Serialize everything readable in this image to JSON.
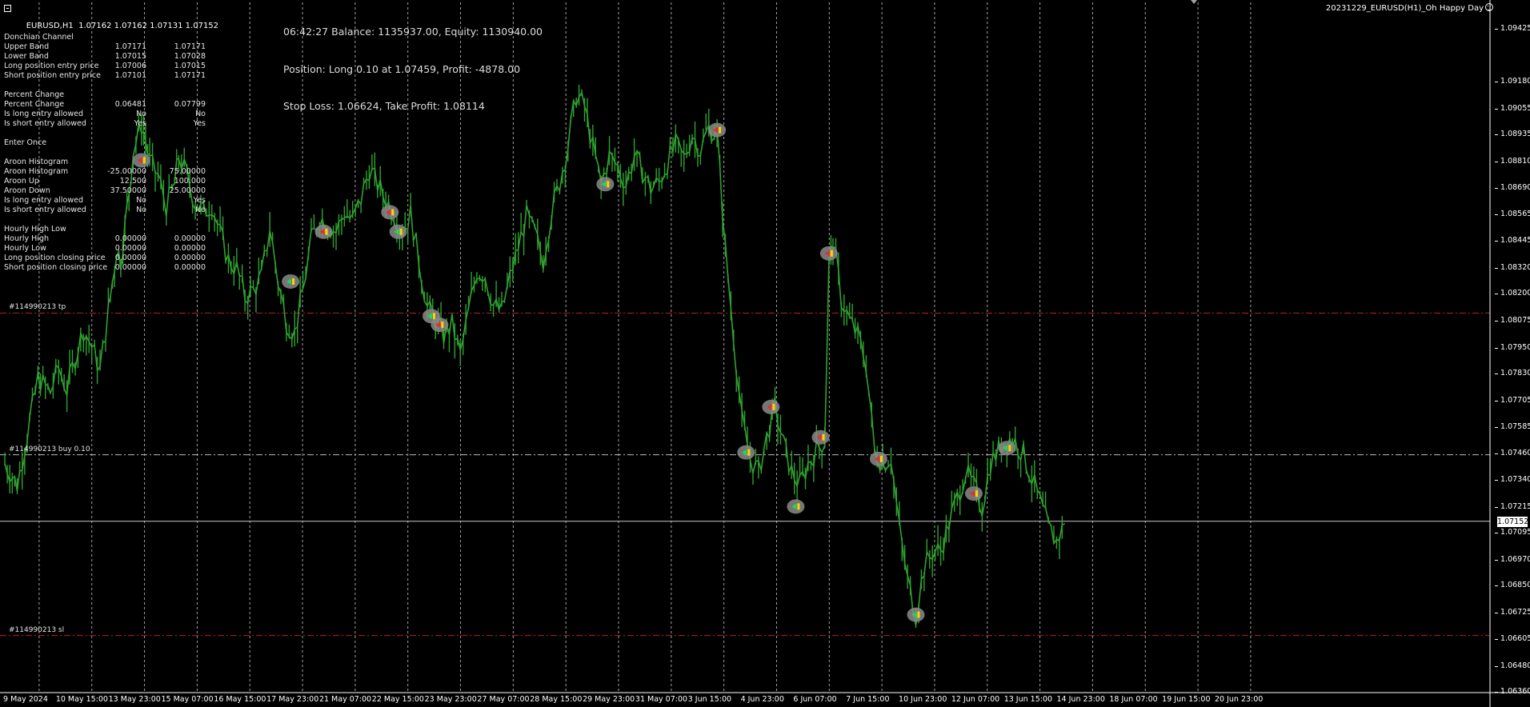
{
  "window": {
    "symbol_title": "EURUSD,H1  1.07162 1.07162 1.07131 1.07152",
    "ea_name": "20231229_EURUSD(H1)_Oh Happy Day"
  },
  "status": {
    "line1": "06:42:27 Balance: 1135937.00, Equity: 1130940.00",
    "line2": "Position: Long 0.10 at 1.07459, Profit: -4878.00",
    "line3": "Stop Loss: 1.06624, Take Profit: 1.08114"
  },
  "indicators": [
    {
      "label": "Donchian Channel",
      "v1": "",
      "v2": ""
    },
    {
      "label": "Upper Band",
      "v1": "1.07171",
      "v2": "1.07171"
    },
    {
      "label": "Lower Band",
      "v1": "1.07015",
      "v2": "1.07028"
    },
    {
      "label": "Long position entry price",
      "v1": "1.07006",
      "v2": "1.07015"
    },
    {
      "label": "Short position entry price",
      "v1": "1.07101",
      "v2": "1.07171"
    },
    {
      "label": "",
      "v1": "",
      "v2": ""
    },
    {
      "label": "Percent Change",
      "v1": "",
      "v2": ""
    },
    {
      "label": "Percent Change",
      "v1": "0.06481",
      "v2": "0.07799"
    },
    {
      "label": "Is long entry allowed",
      "v1": "No",
      "v2": "No"
    },
    {
      "label": "Is short entry allowed",
      "v1": "Yes",
      "v2": "Yes"
    },
    {
      "label": "",
      "v1": "",
      "v2": ""
    },
    {
      "label": "Enter Once",
      "v1": "",
      "v2": ""
    },
    {
      "label": "",
      "v1": "",
      "v2": ""
    },
    {
      "label": "Aroon Histogram",
      "v1": "",
      "v2": ""
    },
    {
      "label": "Aroon Histogram",
      "v1": "-25.00000",
      "v2": "75.00000"
    },
    {
      "label": "Aroon Up",
      "v1": "12.500",
      "v2": "100.000"
    },
    {
      "label": "Aroon Down",
      "v1": "37.50000",
      "v2": "25.00000"
    },
    {
      "label": "Is long entry allowed",
      "v1": "No",
      "v2": "Yes"
    },
    {
      "label": "Is short entry allowed",
      "v1": "No",
      "v2": "No"
    },
    {
      "label": "",
      "v1": "",
      "v2": ""
    },
    {
      "label": "Hourly High Low",
      "v1": "",
      "v2": ""
    },
    {
      "label": "Hourly High",
      "v1": "0.00000",
      "v2": "0.00000"
    },
    {
      "label": "Hourly Low",
      "v1": "0.00000",
      "v2": "0.00000"
    },
    {
      "label": "Long position closing price",
      "v1": "0.00000",
      "v2": "0.00000"
    },
    {
      "label": "Short position closing price",
      "v1": "0.00000",
      "v2": "0.00000"
    }
  ],
  "price_axis": {
    "ticks": [
      "1.09425",
      "1.09180",
      "1.09055",
      "1.08935",
      "1.08810",
      "1.08690",
      "1.08565",
      "1.08445",
      "1.08320",
      "1.08200",
      "1.08075",
      "1.07950",
      "1.07830",
      "1.07705",
      "1.07585",
      "1.07460",
      "1.07340",
      "1.07215",
      "1.07095",
      "1.06970",
      "1.06850",
      "1.06725",
      "1.06605",
      "1.06480",
      "1.06360"
    ],
    "current_price": "1.07152"
  },
  "time_axis": {
    "labels": [
      "9 May 2024",
      "10 May 15:00",
      "13 May 23:00",
      "15 May 07:00",
      "16 May 15:00",
      "17 May 23:00",
      "21 May 07:00",
      "22 May 15:00",
      "23 May 23:00",
      "27 May 07:00",
      "28 May 15:00",
      "29 May 23:00",
      "31 May 07:00",
      "3 Jun 15:00",
      "4 Jun 23:00",
      "6 Jun 07:00",
      "7 Jun 15:00",
      "10 Jun 23:00",
      "12 Jun 07:00",
      "13 Jun 15:00",
      "14 Jun 23:00",
      "18 Jun 07:00",
      "19 Jun 15:00",
      "20 Jun 23:00"
    ]
  },
  "lines": [
    {
      "label": "#114990213 tp",
      "price": 1.08114,
      "color": "#b22222"
    },
    {
      "label": "#114990213 buy 0.10",
      "price": 1.07459,
      "color": "#bcbcbc"
    },
    {
      "label": "#114990213 sl",
      "price": 1.06624,
      "color": "#b22222"
    }
  ],
  "chart_data": {
    "type": "line",
    "colors": {
      "price": "#2fa32f",
      "bid": "#c8c8c8",
      "grid": "#c0c0c0",
      "background": "#000000"
    },
    "ylim": [
      1.0636,
      1.0955
    ],
    "path": [
      [
        0,
        1.0742
      ],
      [
        1.5,
        1.0732
      ],
      [
        3,
        1.0761
      ],
      [
        4,
        1.0781
      ],
      [
        5.5,
        1.0775
      ],
      [
        6.5,
        1.0786
      ],
      [
        7.5,
        1.0776
      ],
      [
        8.5,
        1.0791
      ],
      [
        9.5,
        1.0804
      ],
      [
        10.5,
        1.0796
      ],
      [
        11.5,
        1.0785
      ],
      [
        12.5,
        1.0812
      ],
      [
        13,
        1.0826
      ],
      [
        13.5,
        1.0841
      ],
      [
        14,
        1.0836
      ],
      [
        14.5,
        1.0851
      ],
      [
        15,
        1.0868
      ],
      [
        15.5,
        1.0886
      ],
      [
        16.5,
        1.0899
      ],
      [
        17,
        1.0891
      ],
      [
        17.5,
        1.0881
      ],
      [
        18.5,
        1.0875
      ],
      [
        19.5,
        1.0861
      ],
      [
        20.5,
        1.0871
      ],
      [
        21,
        1.0884
      ],
      [
        22,
        1.0875
      ],
      [
        23,
        1.0862
      ],
      [
        24,
        1.0858
      ],
      [
        25,
        1.0862
      ],
      [
        26,
        1.0848
      ],
      [
        27,
        1.0836
      ],
      [
        28,
        1.0832
      ],
      [
        29,
        1.0819
      ],
      [
        30,
        1.0822
      ],
      [
        31,
        1.0828
      ],
      [
        32,
        1.0851
      ],
      [
        33,
        1.0826
      ],
      [
        34,
        1.0808
      ],
      [
        35,
        1.0802
      ],
      [
        36,
        1.0822
      ],
      [
        37,
        1.0845
      ],
      [
        38,
        1.0856
      ],
      [
        39,
        1.0852
      ],
      [
        40,
        1.0849
      ],
      [
        41,
        1.0858
      ],
      [
        42,
        1.0854
      ],
      [
        43,
        1.0864
      ],
      [
        44,
        1.0878
      ],
      [
        45,
        1.0871
      ],
      [
        46,
        1.0864
      ],
      [
        47,
        1.0858
      ],
      [
        48,
        1.0849
      ],
      [
        49,
        1.0857
      ],
      [
        50,
        1.0836
      ],
      [
        51,
        1.0814
      ],
      [
        52,
        1.0808
      ],
      [
        53,
        1.0801
      ],
      [
        54,
        1.0806
      ],
      [
        55,
        1.0792
      ],
      [
        56,
        1.0812
      ],
      [
        57,
        1.0831
      ],
      [
        58,
        1.0829
      ],
      [
        59,
        1.0815
      ],
      [
        60,
        1.0812
      ],
      [
        61,
        1.0828
      ],
      [
        62,
        1.0842
      ],
      [
        63,
        1.0856
      ],
      [
        64,
        1.0848
      ],
      [
        65,
        1.0836
      ],
      [
        66,
        1.0858
      ],
      [
        67,
        1.0872
      ],
      [
        68,
        1.0889
      ],
      [
        69,
        1.0912
      ],
      [
        70,
        1.0907
      ],
      [
        71,
        1.0888
      ],
      [
        72,
        1.0871
      ],
      [
        73,
        1.0884
      ],
      [
        74,
        1.0879
      ],
      [
        75,
        1.0871
      ],
      [
        76,
        1.0884
      ],
      [
        77,
        1.0877
      ],
      [
        78,
        1.0869
      ],
      [
        79,
        1.0872
      ],
      [
        80,
        1.0881
      ],
      [
        81,
        1.0889
      ],
      [
        82,
        1.0883
      ],
      [
        83,
        1.0894
      ],
      [
        84,
        1.0887
      ],
      [
        85,
        1.0897
      ],
      [
        86,
        1.0894
      ],
      [
        87,
        1.0841
      ],
      [
        88,
        1.0801
      ],
      [
        89,
        1.0762
      ],
      [
        90,
        1.0744
      ],
      [
        91,
        1.0738
      ],
      [
        92,
        1.0754
      ],
      [
        93,
        1.0768
      ],
      [
        94,
        1.0751
      ],
      [
        95,
        1.0738
      ],
      [
        96,
        1.0732
      ],
      [
        97,
        1.0742
      ],
      [
        98,
        1.0748
      ],
      [
        99,
        1.0753
      ],
      [
        99.5,
        1.0832
      ],
      [
        100,
        1.0846
      ],
      [
        101,
        1.0818
      ],
      [
        102,
        1.0808
      ],
      [
        103,
        1.0801
      ],
      [
        104,
        1.0788
      ],
      [
        105,
        1.0748
      ],
      [
        106,
        1.0742
      ],
      [
        107,
        1.0745
      ],
      [
        108,
        1.0712
      ],
      [
        109,
        1.0688
      ],
      [
        110,
        1.0672
      ],
      [
        111,
        1.0694
      ],
      [
        112,
        1.0701
      ],
      [
        113,
        1.0702
      ],
      [
        114,
        1.0714
      ],
      [
        115,
        1.0726
      ],
      [
        116,
        1.0738
      ],
      [
        117,
        1.0731
      ],
      [
        118,
        1.0722
      ],
      [
        119,
        1.0742
      ],
      [
        120,
        1.0748
      ],
      [
        121,
        1.0754
      ],
      [
        122,
        1.0752
      ],
      [
        123,
        1.0746
      ],
      [
        124,
        1.0735
      ],
      [
        125,
        1.0724
      ],
      [
        126,
        1.0712
      ],
      [
        127,
        1.0706
      ],
      [
        128,
        1.0714
      ]
    ],
    "trades": [
      {
        "index": 34.5,
        "price": 1.0826,
        "type": "buy"
      },
      {
        "index": 38.5,
        "price": 1.0849,
        "type": "sell"
      },
      {
        "index": 46.5,
        "price": 1.0858,
        "type": "sell"
      },
      {
        "index": 47.5,
        "price": 1.0849,
        "type": "buy"
      },
      {
        "index": 51.5,
        "price": 1.081,
        "type": "buy"
      },
      {
        "index": 52.5,
        "price": 1.0806,
        "type": "sell"
      },
      {
        "index": 72.5,
        "price": 1.0871,
        "type": "buy"
      },
      {
        "index": 86,
        "price": 1.0896,
        "type": "sell"
      },
      {
        "index": 89.5,
        "price": 1.0747,
        "type": "buy"
      },
      {
        "index": 92.5,
        "price": 1.0768,
        "type": "sell"
      },
      {
        "index": 95.5,
        "price": 1.0722,
        "type": "buy"
      },
      {
        "index": 98.5,
        "price": 1.0754,
        "type": "sell"
      },
      {
        "index": 99.5,
        "price": 1.0839,
        "type": "sell"
      },
      {
        "index": 105.5,
        "price": 1.0744,
        "type": "sell"
      },
      {
        "index": 110,
        "price": 1.0672,
        "type": "buy"
      },
      {
        "index": 117,
        "price": 1.0728,
        "type": "sell"
      },
      {
        "index": 121,
        "price": 1.0749,
        "type": "buy"
      },
      {
        "index": 16.5,
        "price": 1.0882,
        "type": "sell"
      }
    ]
  }
}
